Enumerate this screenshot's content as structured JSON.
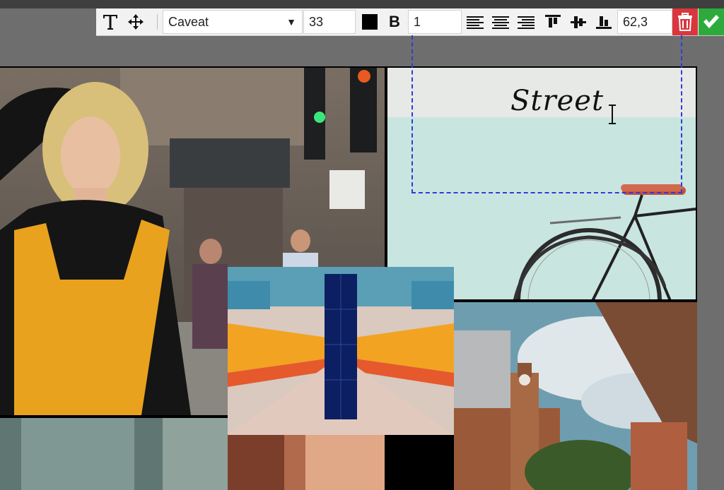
{
  "toolbar": {
    "font_name": "Caveat",
    "font_size": "33",
    "color": "#000000",
    "bold_label": "B",
    "line_spacing": "1",
    "position": "62,3",
    "delete_color": "#d9363e",
    "confirm_color": "#2eaa3c"
  },
  "canvas": {
    "text_content": "Street"
  },
  "icons": [
    "text-tool-icon",
    "move-icon",
    "align-left-icon",
    "align-center-icon",
    "align-right-icon",
    "valign-top-icon",
    "valign-middle-icon",
    "valign-bottom-icon",
    "trash-icon",
    "checkmark-icon"
  ]
}
